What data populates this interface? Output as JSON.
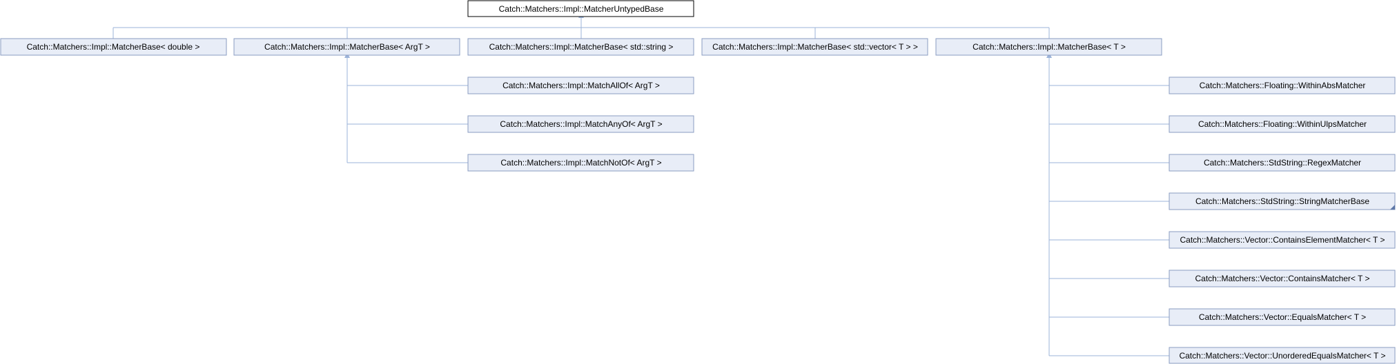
{
  "diagram": {
    "root": "Catch::Matchers::Impl::MatcherUntypedBase",
    "level1": [
      "Catch::Matchers::Impl::MatcherBase< double >",
      "Catch::Matchers::Impl::MatcherBase< ArgT >",
      "Catch::Matchers::Impl::MatcherBase< std::string >",
      "Catch::Matchers::Impl::MatcherBase< std::vector< T > >",
      "Catch::Matchers::Impl::MatcherBase< T >"
    ],
    "argt_children": [
      "Catch::Matchers::Impl::MatchAllOf< ArgT >",
      "Catch::Matchers::Impl::MatchAnyOf< ArgT >",
      "Catch::Matchers::Impl::MatchNotOf< ArgT >"
    ],
    "t_children": [
      "Catch::Matchers::Floating::WithinAbsMatcher",
      "Catch::Matchers::Floating::WithinUlpsMatcher",
      "Catch::Matchers::StdString::RegexMatcher",
      "Catch::Matchers::StdString::StringMatcherBase",
      "Catch::Matchers::Vector::ContainsElementMatcher< T >",
      "Catch::Matchers::Vector::ContainsMatcher< T >",
      "Catch::Matchers::Vector::EqualsMatcher< T >",
      "Catch::Matchers::Vector::UnorderedEqualsMatcher< T >"
    ],
    "colors": {
      "node_fill": "#e8edf7",
      "node_stroke": "#8a9cc2",
      "edge": "#9bb3d9",
      "root_stroke": "#000000"
    }
  }
}
